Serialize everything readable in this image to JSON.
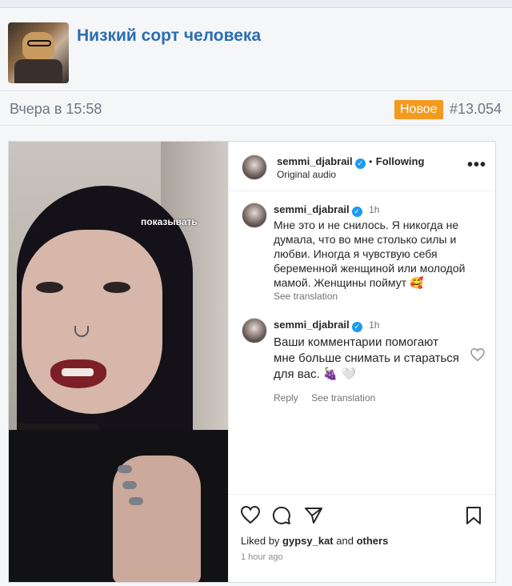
{
  "thread": {
    "title": "Низкий сорт человека",
    "date": "Вчера в 15:58",
    "badge": "Новое",
    "post_number": "#13.054"
  },
  "video": {
    "caption": "показывать"
  },
  "instagram": {
    "header": {
      "username": "semmi_djabrail",
      "separator": "•",
      "follow_status": "Following",
      "audio": "Original audio",
      "menu_icon": "more-dots-icon"
    },
    "comments": [
      {
        "username": "semmi_djabrail",
        "time": "1h",
        "text": "Мне это и не снилось. Я никогда не думала, что во мне столько силы и любви. Иногда я чувствую себя беременной женщиной или молодой мамой. Женщины поймут 🥰",
        "see_translation": "See translation"
      },
      {
        "username": "semmi_djabrail",
        "time": "1h",
        "text": "Ваши комментарии помогают мне больше снимать и стараться для вас. 🍇 🤍",
        "reply": "Reply",
        "see_translation": "See translation"
      }
    ],
    "likes": {
      "prefix": "Liked by",
      "user": "gypsy_kat",
      "conjunction": "and",
      "others": "others"
    },
    "posted_ago": "1 hour ago"
  },
  "colors": {
    "title": "#2a6db2",
    "badge": "#f39a1f",
    "verified": "#1d9bf0"
  }
}
